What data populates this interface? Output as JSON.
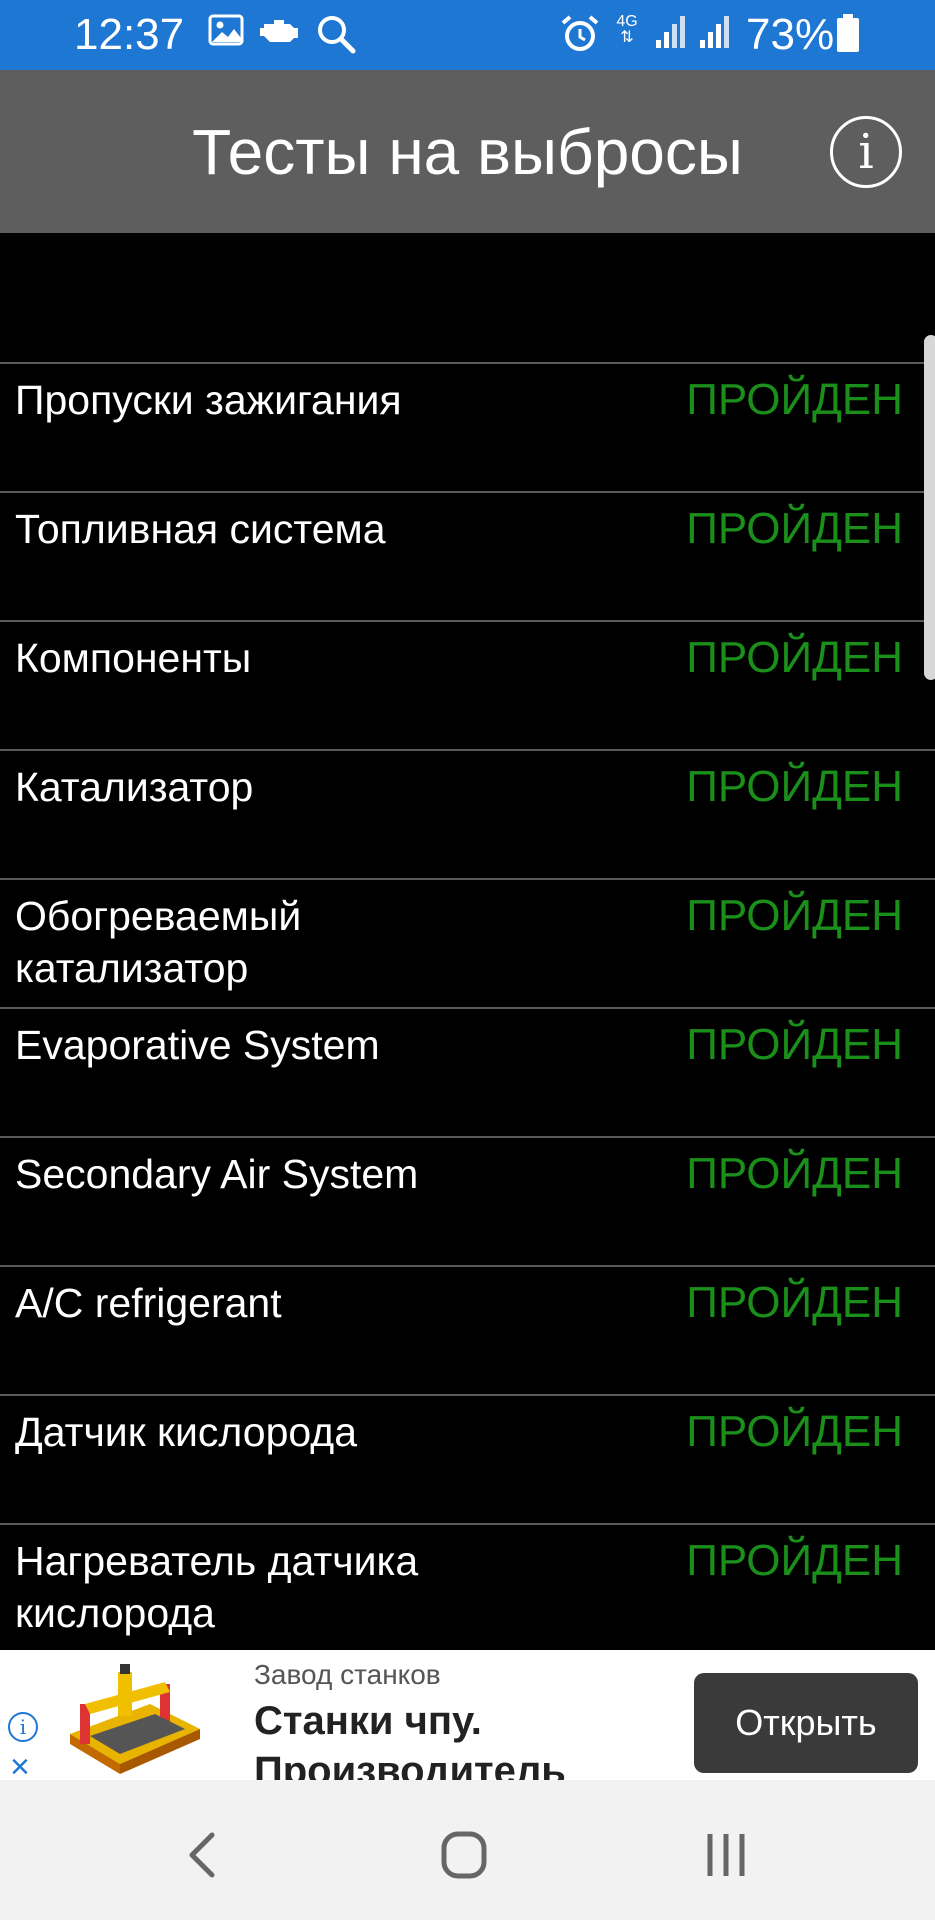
{
  "status_bar": {
    "time": "12:37",
    "network_label": "4G",
    "battery_percent": "73%",
    "icons": [
      "gallery-icon",
      "car-engine-icon",
      "search-icon",
      "alarm-icon",
      "network-4g-icon",
      "signal-icon",
      "signal-icon",
      "battery-icon"
    ]
  },
  "app_bar": {
    "title": "Тесты на выбросы",
    "info_icon": "info-icon"
  },
  "tests": [
    {
      "name": "Пропуски зажигания",
      "status": "ПРОЙДЕН"
    },
    {
      "name": "Топливная система",
      "status": "ПРОЙДЕН"
    },
    {
      "name": "Компоненты",
      "status": "ПРОЙДЕН"
    },
    {
      "name": "Катализатор",
      "status": "ПРОЙДЕН"
    },
    {
      "name": "Обогреваемый катализатор",
      "status": "ПРОЙДЕН"
    },
    {
      "name": "Evaporative System",
      "status": "ПРОЙДЕН"
    },
    {
      "name": "Secondary Air System",
      "status": "ПРОЙДЕН"
    },
    {
      "name": "A/C refrigerant",
      "status": "ПРОЙДЕН"
    },
    {
      "name": "Датчик кислорода",
      "status": "ПРОЙДЕН"
    },
    {
      "name": "Нагреватель датчика кислорода",
      "status": "ПРОЙДЕН"
    }
  ],
  "ad": {
    "advertiser": "Завод станков",
    "headline": "Станки чпу. Производитель",
    "button_label": "Открыть"
  },
  "nav_bar": {
    "icons": [
      "back-icon",
      "home-icon",
      "recents-icon"
    ]
  },
  "colors": {
    "status_bar": "#1f77d4",
    "app_bar": "#5e5e5e",
    "passed_status": "#1a8f1a",
    "background": "#000000"
  }
}
